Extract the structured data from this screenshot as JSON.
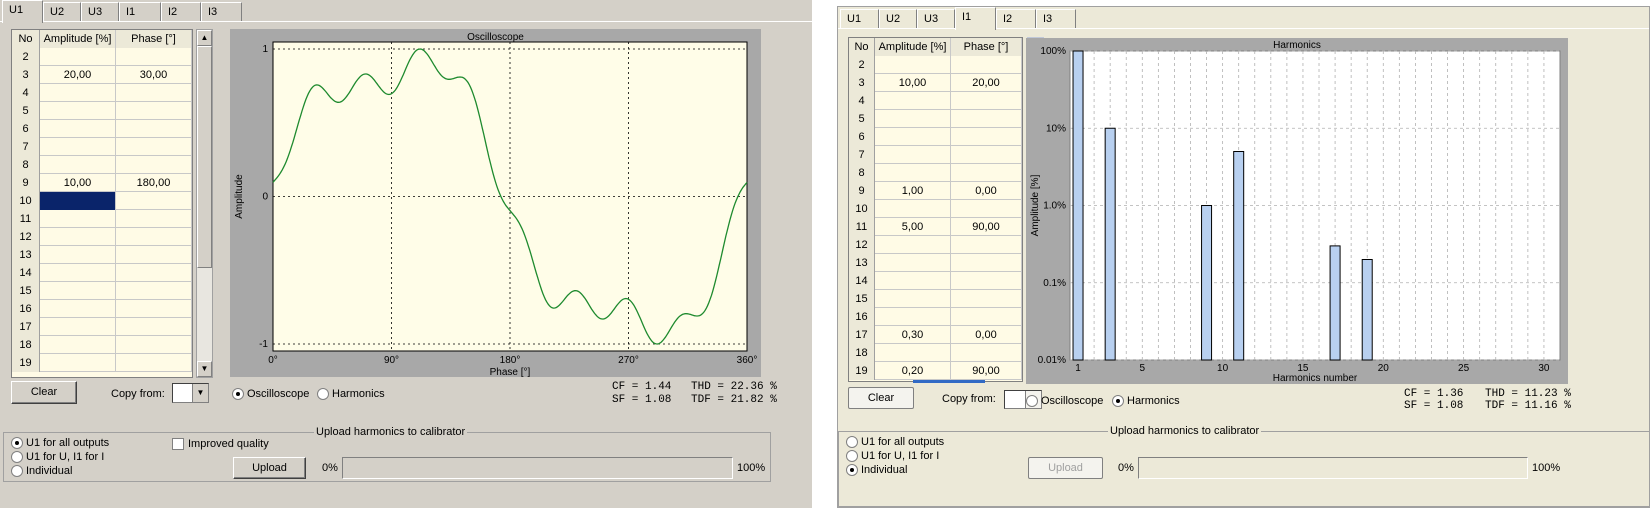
{
  "left": {
    "tabs": [
      "U1",
      "U2",
      "U3",
      "I1",
      "I2",
      "I3"
    ],
    "active_tab": "U1",
    "table": {
      "headers": {
        "no": "No",
        "amplitude": "Amplitude [%]",
        "phase": "Phase [°]"
      },
      "rows": [
        {
          "no": "2",
          "amplitude": "",
          "phase": ""
        },
        {
          "no": "3",
          "amplitude": "20,00",
          "phase": "30,00"
        },
        {
          "no": "4",
          "amplitude": "",
          "phase": ""
        },
        {
          "no": "5",
          "amplitude": "",
          "phase": ""
        },
        {
          "no": "6",
          "amplitude": "",
          "phase": ""
        },
        {
          "no": "7",
          "amplitude": "",
          "phase": ""
        },
        {
          "no": "8",
          "amplitude": "",
          "phase": ""
        },
        {
          "no": "9",
          "amplitude": "10,00",
          "phase": "180,00"
        },
        {
          "no": "10",
          "amplitude": "",
          "phase": ""
        },
        {
          "no": "11",
          "amplitude": "",
          "phase": ""
        },
        {
          "no": "12",
          "amplitude": "",
          "phase": ""
        },
        {
          "no": "13",
          "amplitude": "",
          "phase": ""
        },
        {
          "no": "14",
          "amplitude": "",
          "phase": ""
        },
        {
          "no": "15",
          "amplitude": "",
          "phase": ""
        },
        {
          "no": "16",
          "amplitude": "",
          "phase": ""
        },
        {
          "no": "17",
          "amplitude": "",
          "phase": ""
        },
        {
          "no": "18",
          "amplitude": "",
          "phase": ""
        },
        {
          "no": "19",
          "amplitude": "",
          "phase": ""
        }
      ],
      "selected_row": "10"
    },
    "clear_label": "Clear",
    "copy_from_label": "Copy from:",
    "copy_from_value": "",
    "view_options": {
      "oscilloscope": "Oscilloscope",
      "harmonics": "Harmonics",
      "selected": "oscilloscope"
    },
    "stats": {
      "cf": "CF =  1.44",
      "sf": "SF =  1.08",
      "thd": "THD =  22.36 %",
      "tdf": "TDF =  21.82 %"
    },
    "upload": {
      "group_title": "Upload harmonics to calibrator",
      "options": [
        "U1 for all outputs",
        "U1 for U, I1 for I",
        "Individual"
      ],
      "selected_option": 0,
      "improved_quality_label": "Improved quality",
      "improved_quality_checked": false,
      "upload_label": "Upload",
      "progress_min": "0%",
      "progress_max": "100%",
      "progress_value": 0
    }
  },
  "right": {
    "tabs": [
      "U1",
      "U2",
      "U3",
      "I1",
      "I2",
      "I3"
    ],
    "active_tab": "I1",
    "table": {
      "headers": {
        "no": "No",
        "amplitude": "Amplitude [%]",
        "phase": "Phase [°]"
      },
      "rows": [
        {
          "no": "2",
          "amplitude": "",
          "phase": ""
        },
        {
          "no": "3",
          "amplitude": "10,00",
          "phase": "20,00"
        },
        {
          "no": "4",
          "amplitude": "",
          "phase": ""
        },
        {
          "no": "5",
          "amplitude": "",
          "phase": ""
        },
        {
          "no": "6",
          "amplitude": "",
          "phase": ""
        },
        {
          "no": "7",
          "amplitude": "",
          "phase": ""
        },
        {
          "no": "8",
          "amplitude": "",
          "phase": ""
        },
        {
          "no": "9",
          "amplitude": "1,00",
          "phase": "0,00"
        },
        {
          "no": "10",
          "amplitude": "",
          "phase": ""
        },
        {
          "no": "11",
          "amplitude": "5,00",
          "phase": "90,00"
        },
        {
          "no": "12",
          "amplitude": "",
          "phase": ""
        },
        {
          "no": "13",
          "amplitude": "",
          "phase": ""
        },
        {
          "no": "14",
          "amplitude": "",
          "phase": ""
        },
        {
          "no": "15",
          "amplitude": "",
          "phase": ""
        },
        {
          "no": "16",
          "amplitude": "",
          "phase": ""
        },
        {
          "no": "17",
          "amplitude": "0,30",
          "phase": "0,00"
        },
        {
          "no": "18",
          "amplitude": "",
          "phase": ""
        },
        {
          "no": "19",
          "amplitude": "0,20",
          "phase": "90,00"
        }
      ]
    },
    "clear_label": "Clear",
    "copy_from_label": "Copy from:",
    "copy_from_value": "",
    "view_options": {
      "oscilloscope": "Oscilloscope",
      "harmonics": "Harmonics",
      "selected": "harmonics"
    },
    "stats": {
      "cf": "CF =  1.36",
      "sf": "SF =  1.08",
      "thd": "THD =  11.23 %",
      "tdf": "TDF =  11.16 %"
    },
    "upload": {
      "group_title": "Upload harmonics to calibrator",
      "options": [
        "U1 for all outputs",
        "U1 for U, I1 for I",
        "Individual"
      ],
      "selected_option": 2,
      "upload_label": "Upload",
      "progress_min": "0%",
      "progress_max": "100%",
      "progress_value": 0
    }
  },
  "chart_data": [
    {
      "type": "line",
      "title": "Oscilloscope",
      "xlabel": "Phase [°]",
      "ylabel": "Amplitude",
      "x_ticks": [
        "0°",
        "90°",
        "180°",
        "270°",
        "360°"
      ],
      "y_ticks": [
        "1",
        "0",
        "-1"
      ],
      "xlim": [
        0,
        360
      ],
      "ylim": [
        -1,
        1
      ],
      "grid": true,
      "line_color": "#1e8a2e",
      "background_color": "#fffde8",
      "series": [
        {
          "harmonics": [
            {
              "order": 1,
              "amplitude_pct": 100,
              "phase_deg": 0
            },
            {
              "order": 3,
              "amplitude_pct": 20,
              "phase_deg": 30
            },
            {
              "order": 9,
              "amplitude_pct": 10,
              "phase_deg": 180
            }
          ]
        }
      ]
    },
    {
      "type": "bar",
      "title": "Harmonics",
      "xlabel": "Harmonics number",
      "ylabel": "Amplitude [%]",
      "yscale": "log",
      "ylim": [
        0.01,
        100
      ],
      "xlim": [
        0.5,
        31
      ],
      "y_ticks": [
        "100%",
        "10%",
        "1.0%",
        "0.1%",
        "0.01%"
      ],
      "x_ticks": [
        "1",
        "5",
        "10",
        "15",
        "20",
        "25",
        "30"
      ],
      "grid": true,
      "bar_color": "#b8d0f0",
      "categories": [
        1,
        3,
        9,
        11,
        17,
        19
      ],
      "values": [
        100,
        10,
        1,
        5,
        0.3,
        0.2
      ]
    }
  ]
}
